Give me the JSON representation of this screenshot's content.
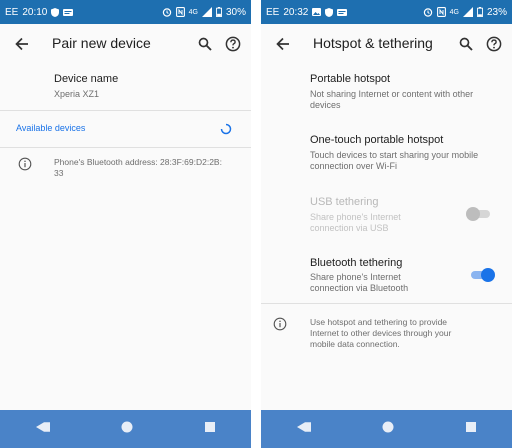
{
  "left": {
    "statusbar": {
      "carrier": "EE",
      "time": "20:10",
      "network": "4G",
      "battery": "30%"
    },
    "appbar": {
      "title": "Pair new device"
    },
    "device_name": {
      "label": "Device name",
      "value": "Xperia XZ1"
    },
    "available_devices": {
      "label": "Available devices"
    },
    "bt_address": {
      "line1": "Phone's Bluetooth address: 28:3F:69:D2:2B:",
      "line2": "33"
    }
  },
  "right": {
    "statusbar": {
      "carrier": "EE",
      "time": "20:32",
      "network": "4G",
      "battery": "23%"
    },
    "appbar": {
      "title": "Hotspot & tethering"
    },
    "portable_hotspot": {
      "title": "Portable hotspot",
      "line1": "Not sharing Internet or content with other",
      "line2": "devices"
    },
    "one_touch": {
      "title": "One-touch portable hotspot",
      "line1": "Touch devices to start sharing your mobile",
      "line2": "connection over Wi-Fi"
    },
    "usb_tethering": {
      "title": "USB tethering",
      "line1": "Share phone's Internet",
      "line2": "connection via USB",
      "enabled": false,
      "checked": false
    },
    "bt_tethering": {
      "title": "Bluetooth tethering",
      "line1": "Share phone's Internet",
      "line2": "connection via Bluetooth",
      "enabled": true,
      "checked": true
    },
    "info": {
      "line1": "Use hotspot and tethering to provide",
      "line2": "Internet to other devices through your",
      "line3": "mobile data connection."
    }
  },
  "colors": {
    "statusbar": "#1e6fb0",
    "navbar": "#4a83c8",
    "accent": "#1a73e8",
    "text": "#202020",
    "secondary": "#6e6e6e"
  },
  "icons": [
    "back-arrow-icon",
    "search-icon",
    "help-icon",
    "info-icon",
    "spinner-icon",
    "nav-back-icon",
    "nav-home-icon",
    "nav-recents-icon"
  ]
}
